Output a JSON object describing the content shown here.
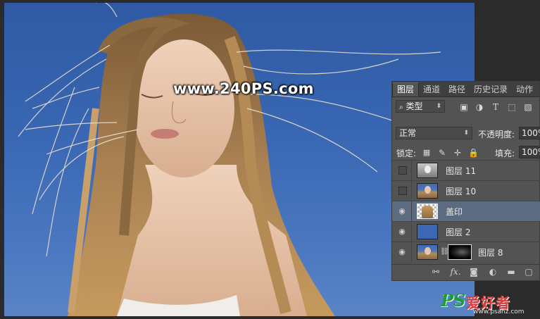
{
  "watermark": "www.240PS.com",
  "panel": {
    "tabs": [
      "图层",
      "通道",
      "路径",
      "历史记录",
      "动作"
    ],
    "filter_kind": "类型",
    "blend_mode": "正常",
    "opacity_label": "不透明度:",
    "opacity_value": "100%",
    "lock_label": "锁定:",
    "fill_label": "填充:",
    "fill_value": "100%",
    "layers": [
      {
        "name": "图层 11",
        "visible": false,
        "thumb": "gray"
      },
      {
        "name": "图层 10",
        "visible": false,
        "thumb": "photo"
      },
      {
        "name": "盖印",
        "visible": true,
        "thumb": "checker",
        "active": true
      },
      {
        "name": "图层 2",
        "visible": true,
        "thumb": "solid"
      },
      {
        "name": "图层 8",
        "visible": true,
        "thumb": "photo",
        "has_mask": true
      }
    ],
    "bottom_icons": [
      "link-icon",
      "fx-icon",
      "add-mask-icon",
      "adjustment-icon",
      "folder-icon",
      "new-layer-icon"
    ],
    "bottom_fx": "fx."
  },
  "logo": {
    "ps": "PS",
    "cn": "爱好者",
    "url": "www.psahz.com"
  },
  "colors": {
    "sky": "#3a68b4",
    "panel_bg": "#535353",
    "active_layer": "#5b6b80",
    "logo_green": "#1e9e3a",
    "logo_red": "#e03a3a"
  }
}
